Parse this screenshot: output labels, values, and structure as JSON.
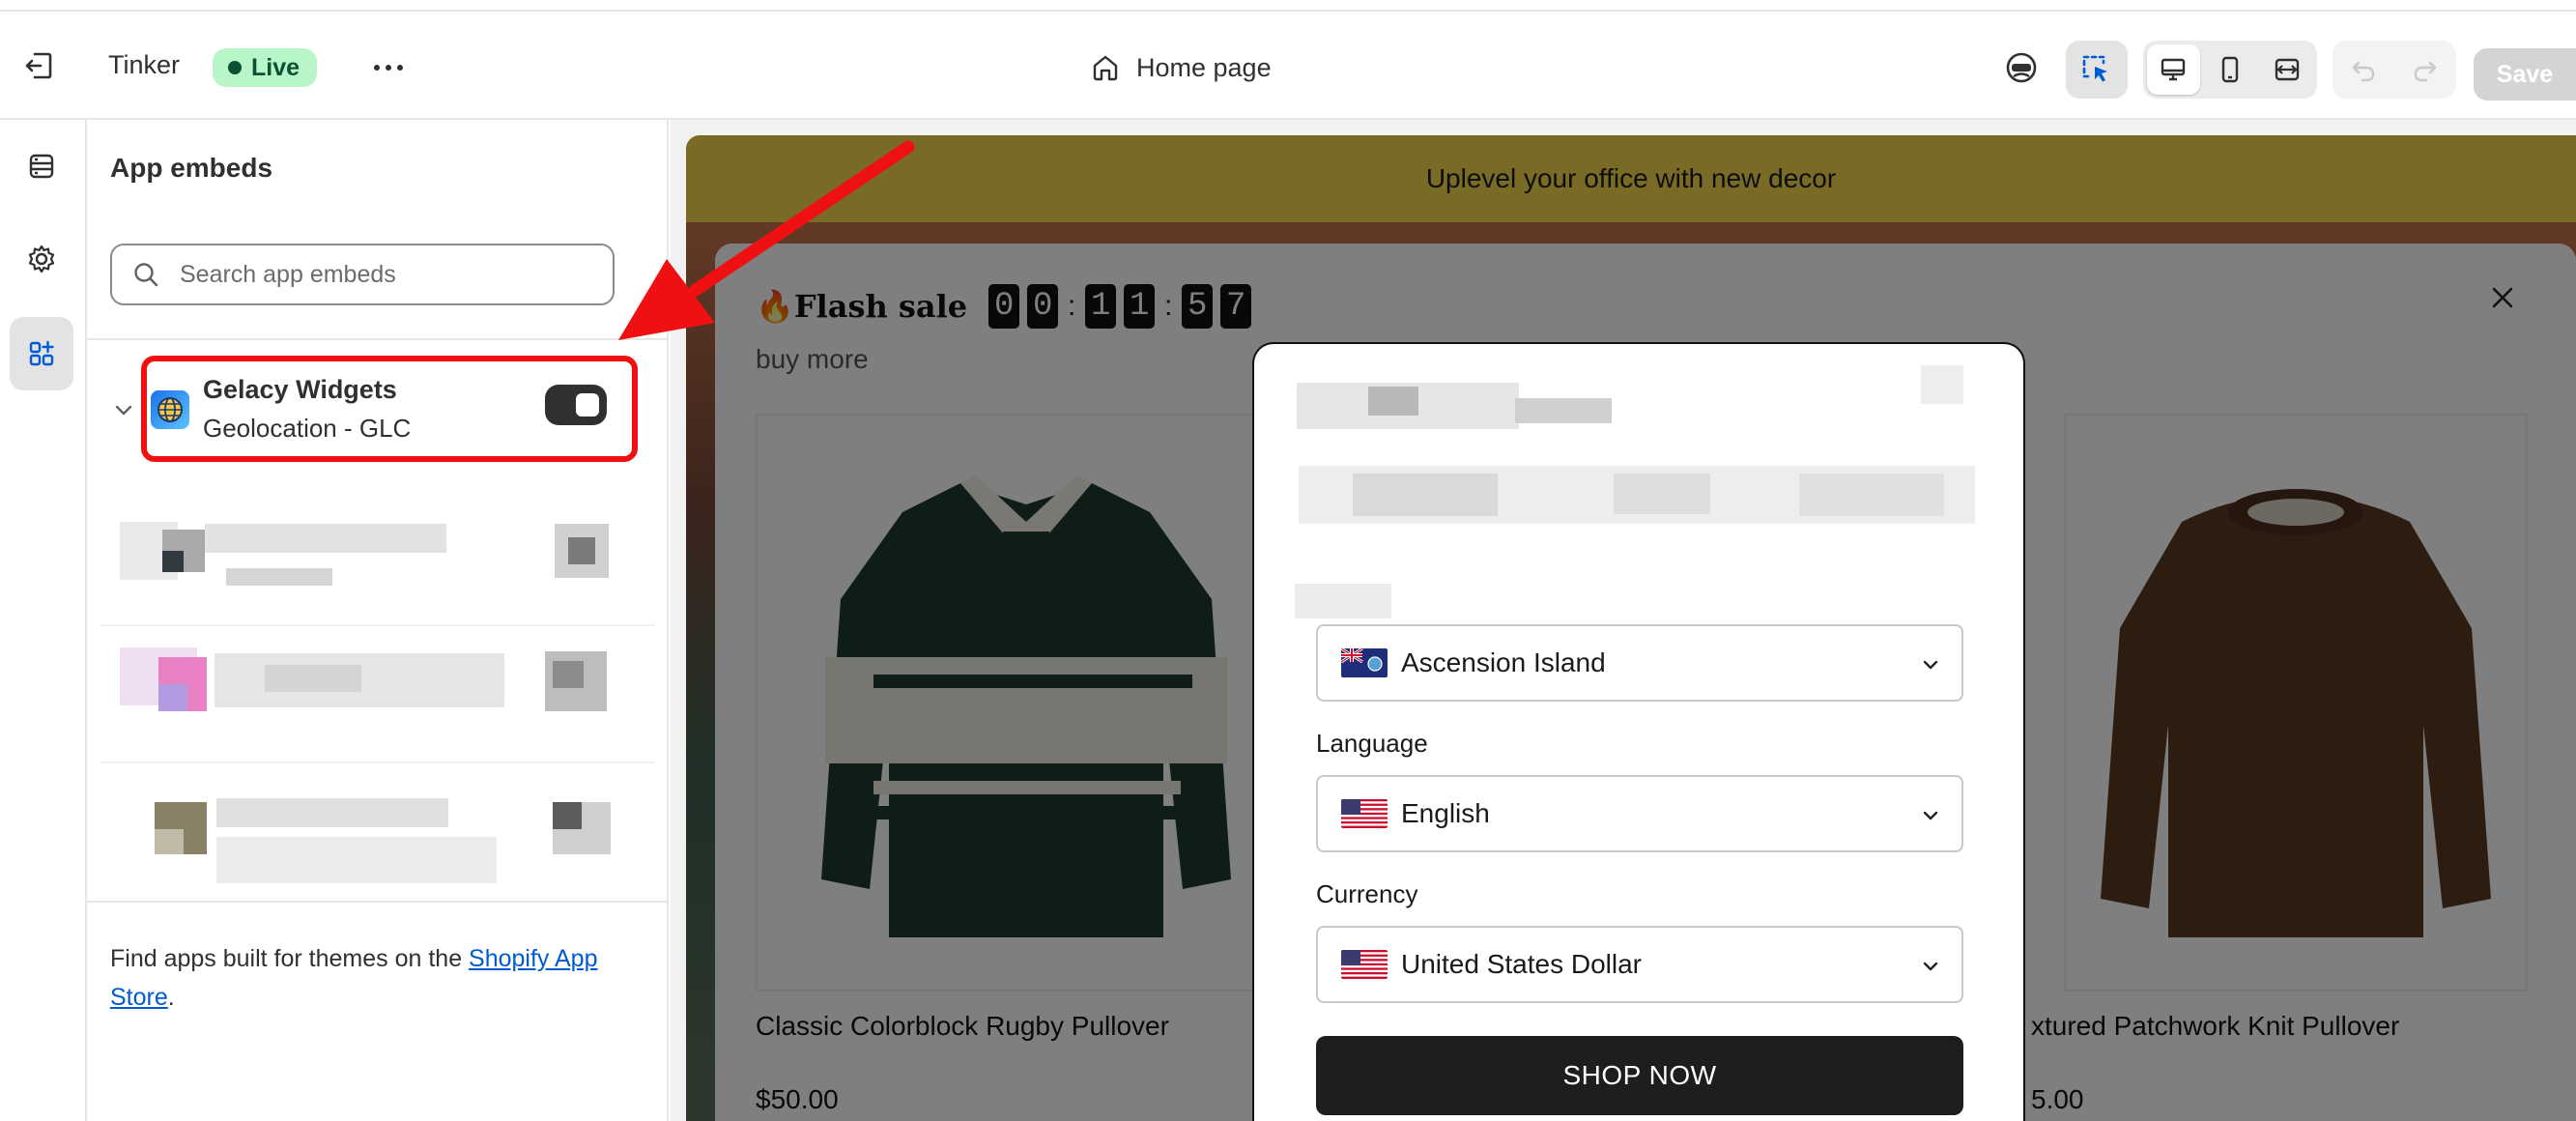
{
  "topbar": {
    "theme_name": "Tinker",
    "status_badge": "Live",
    "page_selector": "Home page",
    "save_label": "Save"
  },
  "sidebar": {
    "title": "App embeds",
    "search_placeholder": "Search app embeds",
    "app": {
      "name": "Gelacy Widgets",
      "subtitle": "Geolocation - GLC",
      "enabled": true
    },
    "footer_text": "Find apps built for themes on the ",
    "footer_link": "Shopify App Store",
    "footer_end": "."
  },
  "preview": {
    "announcement": "Uplevel your office with new decor",
    "flash_sale": {
      "title": "🔥Flash sale",
      "countdown": [
        "0",
        "0",
        "1",
        "1",
        "5",
        "7"
      ],
      "subtitle": "buy more"
    },
    "products": [
      {
        "name": "Classic Colorblock Rugby Pullover",
        "price": "$50.00"
      },
      {
        "name": "xtured Patchwork Knit Pullover",
        "price": "5.00"
      }
    ],
    "geolocation_popup": {
      "country": "Ascension Island",
      "language_label": "Language",
      "language": "English",
      "currency_label": "Currency",
      "currency": "United States Dollar",
      "button": "SHOP NOW"
    }
  },
  "colors": {
    "annotation": "#ef1111",
    "live_badge_bg": "#b8f5c8",
    "live_badge_text": "#0c5132",
    "announcement_bg": "#f2d64b",
    "link": "#005bd3"
  },
  "icons": [
    "exit-icon",
    "more-icon",
    "home-icon",
    "inspector-icon",
    "select-icon",
    "desktop-icon",
    "mobile-icon",
    "fullwidth-icon",
    "undo-icon",
    "redo-icon",
    "sections-icon",
    "settings-icon",
    "app-embeds-icon",
    "search-icon",
    "chevron-down-icon",
    "globe-icon",
    "close-icon"
  ]
}
